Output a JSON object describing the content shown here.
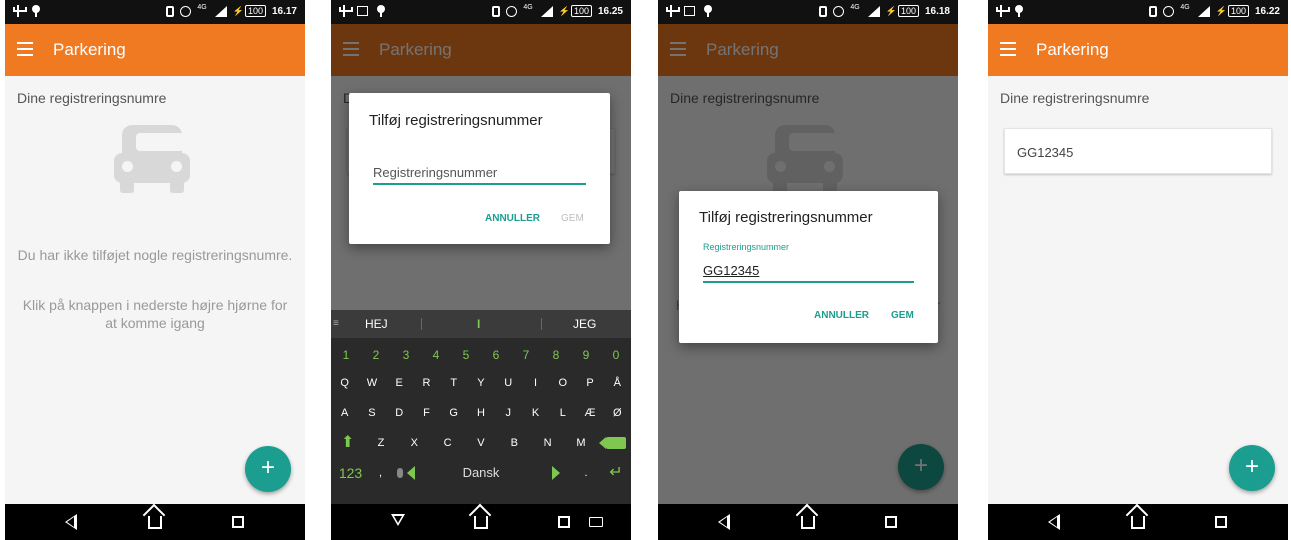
{
  "app": {
    "title": "Parkering"
  },
  "list": {
    "section_label": "Dine registreringsnumre"
  },
  "empty": {
    "line1": "Du har ikke tilføjet nogle registreringsnumre.",
    "line2": "Klik på knappen i nederste højre hjørne for at komme igang"
  },
  "dialog": {
    "title": "Tilføj registreringsnummer",
    "input_placeholder": "Registreringsnummer",
    "input_label": "Registreringsnummer",
    "input_value": "GG12345",
    "cancel_label": "ANNULLER",
    "save_label": "GEM"
  },
  "plates": [
    "GG12345"
  ],
  "fab": {
    "label": "+"
  },
  "status_bars": [
    {
      "network": "4G",
      "battery": "100",
      "time": "16.17"
    },
    {
      "network": "4G",
      "battery": "100",
      "time": "16.25"
    },
    {
      "network": "4G",
      "battery": "100",
      "time": "16.18"
    },
    {
      "network": "4G",
      "battery": "100",
      "time": "16.22"
    }
  ],
  "keyboard": {
    "suggestions": [
      "HEJ",
      "I",
      "JEG"
    ],
    "number_row": [
      "1",
      "2",
      "3",
      "4",
      "5",
      "6",
      "7",
      "8",
      "9",
      "0"
    ],
    "row1": [
      "Q",
      "W",
      "E",
      "R",
      "T",
      "Y",
      "U",
      "I",
      "O",
      "P",
      "Å"
    ],
    "row2": [
      "A",
      "S",
      "D",
      "F",
      "G",
      "H",
      "J",
      "K",
      "L",
      "Æ",
      "Ø"
    ],
    "row3": [
      "Z",
      "X",
      "C",
      "V",
      "B",
      "N",
      "M"
    ],
    "symbols_label": "123",
    "comma_label": ",",
    "space_label": "Dansk",
    "period_label": "."
  },
  "colors": {
    "app_bar": "#f07a22",
    "accent": "#1b9e8f",
    "keyboard_accent": "#7ec850"
  }
}
